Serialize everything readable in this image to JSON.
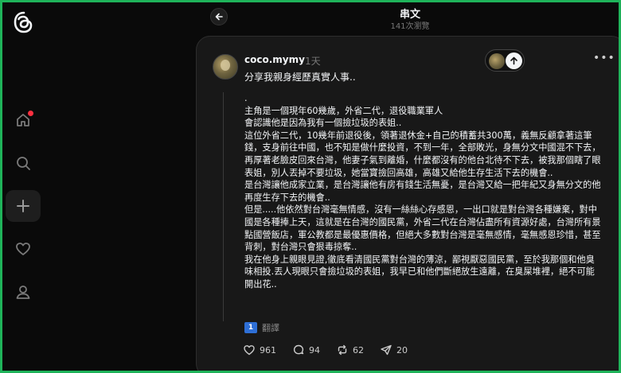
{
  "header": {
    "title": "串文",
    "views": "141次瀏覽"
  },
  "post": {
    "username": "coco.mymy",
    "time": "1天",
    "intro": "分享我親身經歷真實人事..",
    "paragraphs": [
      ".",
      "主角是一個現年60幾歲，外省二代，退役職業軍人",
      "會認識他是因為我有一個撿垃圾的表姐..",
      "這位外省二代，10幾年前退役後，領著退休金+自己的積蓄共300萬，義無反顧拿著這筆錢，支身前往中國，也不知是做什麼投資，不到一年，全部敗光，身無分文中國混不下去，再厚著老臉皮回來台灣，他妻子氣到離婚，什麼都沒有的他台北待不下去，被我那個瞎了眼表姐，別人丟掉不要垃圾，她當寶撿回高雄，高雄又給他生存生活下去的機會..",
      "是台灣讓他成家立業，是台灣讓他有房有錢生活無憂，是台灣又給一把年紀又身無分文的他再度生存下去的機會..",
      "但是.....他依然對台灣毫無情感，沒有一絲絲心存感恩，一出口就是對台灣各種嫌棄，對中國是各種捧上天，這就是在台灣的國民黨，外省二代在台灣佔盡所有資源好處，台灣所有景點國營飯店，軍公教都是最優惠價格，但絕大多數對台灣是毫無感情，毫無感恩珍惜，甚至背刺，對台灣只會狠毒掠奪..",
      "我在他身上親眼見證,徹底看清國民黨對台灣的薄涼，鄙視厭惡國民黨，至於我那個和他臭味相投.丟人現眼只會撿垃圾的表姐，我早已和他們斷絕放生遠離，在臭屎堆裡，絕不可能開出花.."
    ],
    "translate_label": "翻譯",
    "translate_icon_text": "1",
    "likes": "961",
    "comments": "94",
    "reposts": "62",
    "shares": "20"
  },
  "colors": {
    "frame": "#1fb35a",
    "background": "#0a0a0a",
    "card": "#181818",
    "notification": "#ff3040",
    "translate_icon": "#2e6fd6"
  },
  "icons": [
    "threads-logo-icon",
    "home-icon",
    "search-icon",
    "plus-icon",
    "heart-icon",
    "profile-icon",
    "back-arrow-icon",
    "arrow-up-icon",
    "more-icon",
    "comment-icon",
    "repost-icon",
    "share-icon"
  ]
}
